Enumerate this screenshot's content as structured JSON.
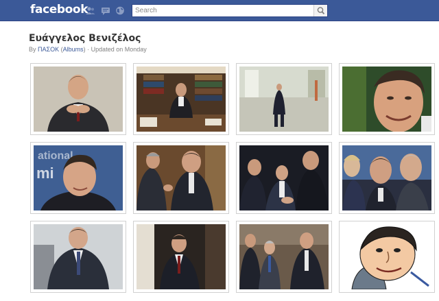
{
  "topbar": {
    "logo": "facebook",
    "search": {
      "placeholder": "Search",
      "value": ""
    },
    "icons": [
      "friend-requests-icon",
      "messages-icon",
      "notifications-globe-icon",
      "search-magnifier-icon"
    ]
  },
  "album": {
    "title": "Ευάγγελος Βενιζέλος",
    "by_prefix": "By",
    "owner": "ΠΑΣΟΚ",
    "albums_open": "(",
    "albums_link": "Albums",
    "albums_close": ")",
    "separator": "·",
    "updated": "Updated on Monday"
  },
  "photos": [
    {
      "name": "photo-1-portrait-hands-clasped"
    },
    {
      "name": "photo-2-office-bookshelf"
    },
    {
      "name": "photo-3-standing-in-hall"
    },
    {
      "name": "photo-4-smiling-closeup"
    },
    {
      "name": "photo-5-closeup-blue-background"
    },
    {
      "name": "photo-6-conversation"
    },
    {
      "name": "photo-7-handshake-group"
    },
    {
      "name": "photo-8-group-of-men"
    },
    {
      "name": "photo-9-standing-portrait"
    },
    {
      "name": "photo-10-walking-in-corridor"
    },
    {
      "name": "photo-11-group-walking"
    },
    {
      "name": "photo-12-caricature"
    }
  ]
}
